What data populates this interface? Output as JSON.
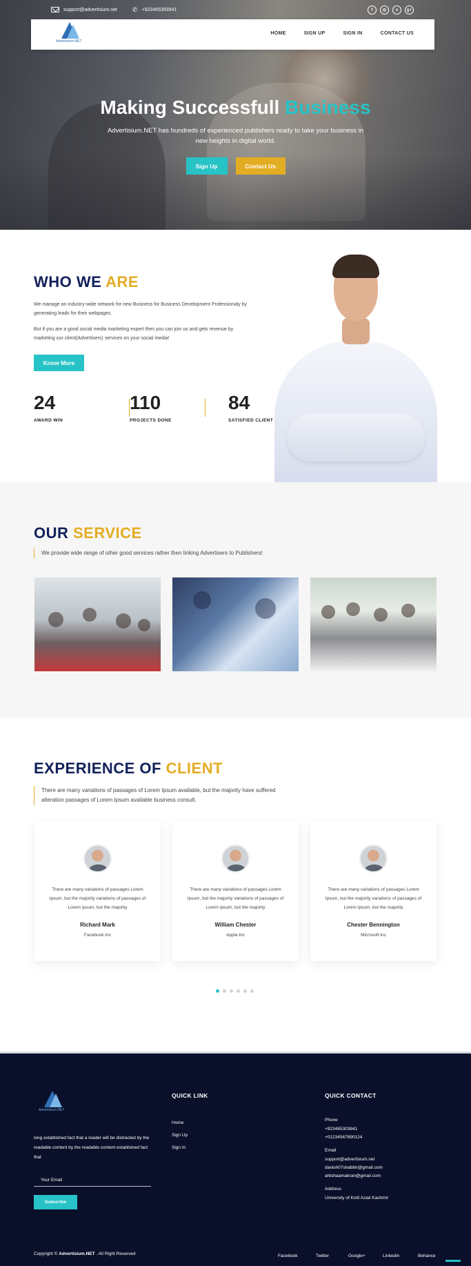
{
  "topbar": {
    "email": "support@advertisium.net",
    "phone": "+923465393941",
    "social": [
      {
        "icon": "facebook-icon",
        "glyph": "f"
      },
      {
        "icon": "instagram-icon",
        "glyph": "◎"
      },
      {
        "icon": "vimeo-icon",
        "glyph": "v"
      },
      {
        "icon": "google-plus-icon",
        "glyph": "g+"
      }
    ]
  },
  "nav": {
    "logo_text": "Advertisium.NET",
    "links": [
      "HOME",
      "SIGN UP",
      "SIGN IN",
      "CONTACT US"
    ]
  },
  "hero": {
    "title_main": "Making Successfull ",
    "title_accent": "Business",
    "subtitle": "Advertisium.NET has hundreds of experienced publishers ready to take your business in new heights in digital world.",
    "signup_label": "Sign Up",
    "contact_label": "Contact Us"
  },
  "who": {
    "title_main": "WHO WE ",
    "title_accent": "ARE",
    "p1": "We manage an industry-wide network for new Business for Business Development Professionaly by generating leads for their webpages.",
    "p2": "But if you are a good social media marketing expert then you can join us and gets revenue by marketing our client(Advertisers) services on your social media!",
    "button": "Know More",
    "stats": [
      {
        "num": "24",
        "label": "AWARD WIN"
      },
      {
        "num": "110",
        "label": "PROJECTS DONE"
      },
      {
        "num": "84",
        "label": "SATISFIED CLIENT"
      }
    ]
  },
  "service": {
    "title_main": "OUR ",
    "title_accent": "SERVICE",
    "lead": "We provide wide range of other good services rather then linking Advertisers to Publishers!"
  },
  "experience": {
    "title_main": "EXPERIENCE OF ",
    "title_accent": "CLIENT",
    "lead": "There are many variations of passages of Lorem Ipsum available, but the majority have suffered alteration passages of Lorem Ipsum available business consult.",
    "testimonials": [
      {
        "quote": "There are many variations of passages Lorem Ipsum, but the majority variations of passages of Lorem Ipsum, but the majority",
        "name": "Richard Mark",
        "company": "Facebook.Inc"
      },
      {
        "quote": "There are many variations of passages Lorem Ipsum, but the majority variations of passages of Lorem Ipsum, but the majority",
        "name": "William Chester",
        "company": "Apple.Inc"
      },
      {
        "quote": "There are many variations of passages Lorem Ipsum, but the majority variations of passages of Lorem Ipsum, but the majority",
        "name": "Chester Bennington",
        "company": "Microsoft.Inc"
      }
    ],
    "carousel_pages": 6,
    "carousel_active": 1
  },
  "footer": {
    "logo_text": "Advertisium.NET",
    "about": "long established fact that a reader will be distracted by the readable content by the readable content established fact that",
    "email_placeholder": "Your Email",
    "subscribe": "Subscribe",
    "quick_link_title": "QUICK LINK",
    "quick_links": [
      "Home",
      "Sign Up",
      "Sign In"
    ],
    "quick_contact_title": "QUICK CONTACT",
    "phone_label": "Phone",
    "phones": [
      "+923465303841",
      "+01234567890124"
    ],
    "email_label": "Email",
    "emails": [
      "support@advertisium.net",
      "danish07shabbir@gmail.com",
      "ahtshaamakran@gmail.com"
    ],
    "address_label": "Address",
    "address": "University of Kotli Azad Kashmir",
    "copyright_prefix": "Copyright © ",
    "copyright_brand": "Advertisium.NET",
    "copyright_suffix": " . All Right Reserved",
    "social": [
      "Facebook",
      "Twitter",
      "Google+",
      "Linkedin",
      "Behance"
    ]
  },
  "colors": {
    "accent_teal": "#27c3c7",
    "accent_gold": "#e3ad23",
    "title_navy": "#12205a",
    "footer_bg": "#0a0f2a"
  }
}
